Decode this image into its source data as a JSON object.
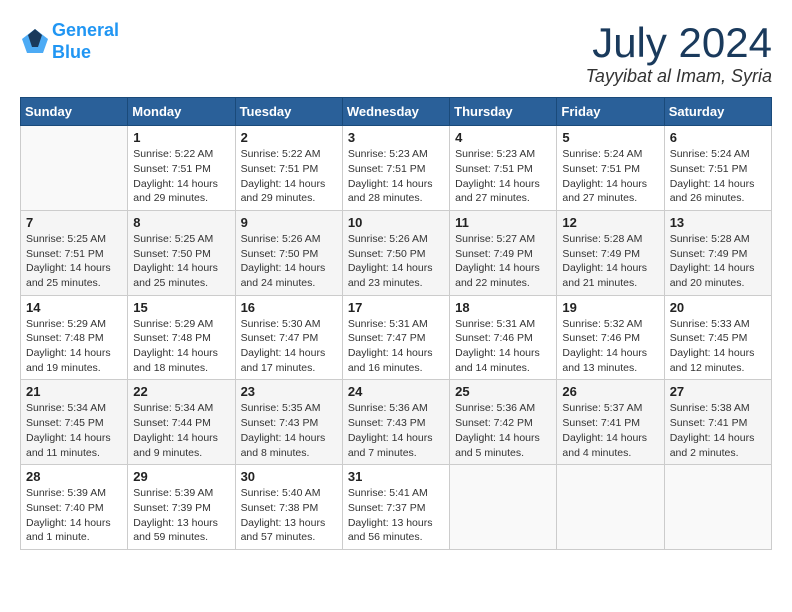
{
  "header": {
    "logo_line1": "General",
    "logo_line2": "Blue",
    "month": "July 2024",
    "location": "Tayyibat al Imam, Syria"
  },
  "weekdays": [
    "Sunday",
    "Monday",
    "Tuesday",
    "Wednesday",
    "Thursday",
    "Friday",
    "Saturday"
  ],
  "weeks": [
    [
      {
        "day": "",
        "info": ""
      },
      {
        "day": "1",
        "info": "Sunrise: 5:22 AM\nSunset: 7:51 PM\nDaylight: 14 hours\nand 29 minutes."
      },
      {
        "day": "2",
        "info": "Sunrise: 5:22 AM\nSunset: 7:51 PM\nDaylight: 14 hours\nand 29 minutes."
      },
      {
        "day": "3",
        "info": "Sunrise: 5:23 AM\nSunset: 7:51 PM\nDaylight: 14 hours\nand 28 minutes."
      },
      {
        "day": "4",
        "info": "Sunrise: 5:23 AM\nSunset: 7:51 PM\nDaylight: 14 hours\nand 27 minutes."
      },
      {
        "day": "5",
        "info": "Sunrise: 5:24 AM\nSunset: 7:51 PM\nDaylight: 14 hours\nand 27 minutes."
      },
      {
        "day": "6",
        "info": "Sunrise: 5:24 AM\nSunset: 7:51 PM\nDaylight: 14 hours\nand 26 minutes."
      }
    ],
    [
      {
        "day": "7",
        "info": "Sunrise: 5:25 AM\nSunset: 7:51 PM\nDaylight: 14 hours\nand 25 minutes."
      },
      {
        "day": "8",
        "info": "Sunrise: 5:25 AM\nSunset: 7:50 PM\nDaylight: 14 hours\nand 25 minutes."
      },
      {
        "day": "9",
        "info": "Sunrise: 5:26 AM\nSunset: 7:50 PM\nDaylight: 14 hours\nand 24 minutes."
      },
      {
        "day": "10",
        "info": "Sunrise: 5:26 AM\nSunset: 7:50 PM\nDaylight: 14 hours\nand 23 minutes."
      },
      {
        "day": "11",
        "info": "Sunrise: 5:27 AM\nSunset: 7:49 PM\nDaylight: 14 hours\nand 22 minutes."
      },
      {
        "day": "12",
        "info": "Sunrise: 5:28 AM\nSunset: 7:49 PM\nDaylight: 14 hours\nand 21 minutes."
      },
      {
        "day": "13",
        "info": "Sunrise: 5:28 AM\nSunset: 7:49 PM\nDaylight: 14 hours\nand 20 minutes."
      }
    ],
    [
      {
        "day": "14",
        "info": "Sunrise: 5:29 AM\nSunset: 7:48 PM\nDaylight: 14 hours\nand 19 minutes."
      },
      {
        "day": "15",
        "info": "Sunrise: 5:29 AM\nSunset: 7:48 PM\nDaylight: 14 hours\nand 18 minutes."
      },
      {
        "day": "16",
        "info": "Sunrise: 5:30 AM\nSunset: 7:47 PM\nDaylight: 14 hours\nand 17 minutes."
      },
      {
        "day": "17",
        "info": "Sunrise: 5:31 AM\nSunset: 7:47 PM\nDaylight: 14 hours\nand 16 minutes."
      },
      {
        "day": "18",
        "info": "Sunrise: 5:31 AM\nSunset: 7:46 PM\nDaylight: 14 hours\nand 14 minutes."
      },
      {
        "day": "19",
        "info": "Sunrise: 5:32 AM\nSunset: 7:46 PM\nDaylight: 14 hours\nand 13 minutes."
      },
      {
        "day": "20",
        "info": "Sunrise: 5:33 AM\nSunset: 7:45 PM\nDaylight: 14 hours\nand 12 minutes."
      }
    ],
    [
      {
        "day": "21",
        "info": "Sunrise: 5:34 AM\nSunset: 7:45 PM\nDaylight: 14 hours\nand 11 minutes."
      },
      {
        "day": "22",
        "info": "Sunrise: 5:34 AM\nSunset: 7:44 PM\nDaylight: 14 hours\nand 9 minutes."
      },
      {
        "day": "23",
        "info": "Sunrise: 5:35 AM\nSunset: 7:43 PM\nDaylight: 14 hours\nand 8 minutes."
      },
      {
        "day": "24",
        "info": "Sunrise: 5:36 AM\nSunset: 7:43 PM\nDaylight: 14 hours\nand 7 minutes."
      },
      {
        "day": "25",
        "info": "Sunrise: 5:36 AM\nSunset: 7:42 PM\nDaylight: 14 hours\nand 5 minutes."
      },
      {
        "day": "26",
        "info": "Sunrise: 5:37 AM\nSunset: 7:41 PM\nDaylight: 14 hours\nand 4 minutes."
      },
      {
        "day": "27",
        "info": "Sunrise: 5:38 AM\nSunset: 7:41 PM\nDaylight: 14 hours\nand 2 minutes."
      }
    ],
    [
      {
        "day": "28",
        "info": "Sunrise: 5:39 AM\nSunset: 7:40 PM\nDaylight: 14 hours\nand 1 minute."
      },
      {
        "day": "29",
        "info": "Sunrise: 5:39 AM\nSunset: 7:39 PM\nDaylight: 13 hours\nand 59 minutes."
      },
      {
        "day": "30",
        "info": "Sunrise: 5:40 AM\nSunset: 7:38 PM\nDaylight: 13 hours\nand 57 minutes."
      },
      {
        "day": "31",
        "info": "Sunrise: 5:41 AM\nSunset: 7:37 PM\nDaylight: 13 hours\nand 56 minutes."
      },
      {
        "day": "",
        "info": ""
      },
      {
        "day": "",
        "info": ""
      },
      {
        "day": "",
        "info": ""
      }
    ]
  ]
}
